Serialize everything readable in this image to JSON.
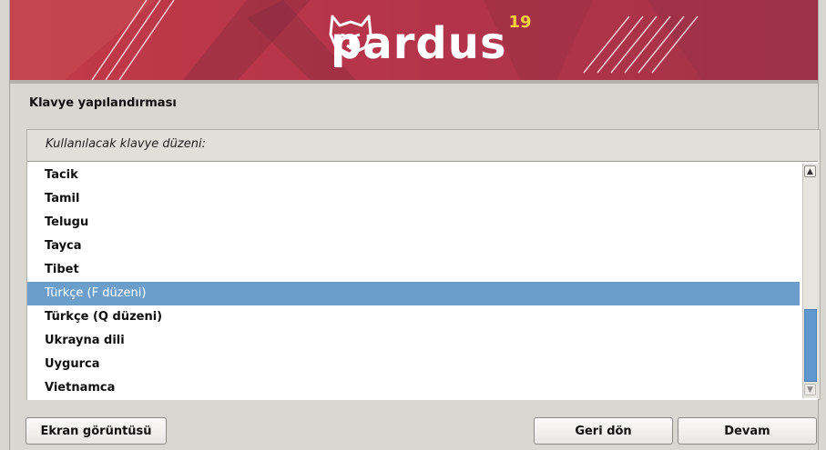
{
  "banner": {
    "logo_text": "pardus",
    "logo_version": "19",
    "icon": "lynx-head-icon"
  },
  "section_title": "Klavye yapılandırması",
  "question": "Kullanılacak klavye düzeni:",
  "keyboard_list": {
    "items": [
      {
        "label": "Tacik",
        "selected": false
      },
      {
        "label": "Tamil",
        "selected": false
      },
      {
        "label": "Telugu",
        "selected": false
      },
      {
        "label": "Tayca",
        "selected": false
      },
      {
        "label": "Tibet",
        "selected": false
      },
      {
        "label": "Türkçe (F düzeni)",
        "selected": true
      },
      {
        "label": "Türkçe (Q düzeni)",
        "selected": false
      },
      {
        "label": "Ukrayna dili",
        "selected": false
      },
      {
        "label": "Uygurca",
        "selected": false
      },
      {
        "label": "Vietnamca",
        "selected": false
      }
    ]
  },
  "buttons": {
    "screenshot": "Ekran görüntüsü",
    "back": "Geri dön",
    "continue": "Devam"
  },
  "colors": {
    "banner_red": "#b7354a",
    "selection_blue": "#6c9ecb",
    "logo_accent": "#f3d23a"
  }
}
